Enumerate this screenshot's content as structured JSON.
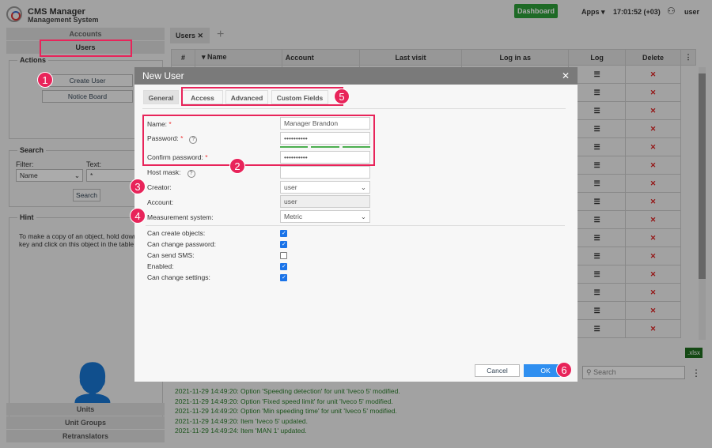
{
  "header": {
    "title": "CMS Manager",
    "subtitle": "Management System",
    "dashboard": "Dashboard",
    "apps": "Apps",
    "time": "17:01:52 (+03)",
    "user": "user"
  },
  "sidebar": {
    "accounts": "Accounts",
    "users": "Users",
    "actions": "Actions",
    "create_user": "Create User",
    "notice_board": "Notice Board",
    "search": "Search",
    "filter_label": "Filter:",
    "filter_value": "Name",
    "text_label": "Text:",
    "text_value": "*",
    "search_btn": "Search",
    "hint": "Hint",
    "hint_text": "To make a copy of an object, hold down Ctrl key and click on this object in the table",
    "units": "Units",
    "unit_groups": "Unit Groups",
    "retranslators": "Retranslators"
  },
  "main": {
    "tab": "Users",
    "columns": [
      "#",
      "Name",
      "Account",
      "Last visit",
      "Log in as",
      "Log",
      "Delete"
    ],
    "xlsx": ".xlsx",
    "search_placeholder": "Search"
  },
  "log": [
    "2021-11-29 14:49:20: Option 'Speeding detection' for unit 'Iveco 5' modified.",
    "2021-11-29 14:49:20: Option 'Fixed speed limit' for unit 'Iveco 5' modified.",
    "2021-11-29 14:49:20: Option 'Min speeding time' for unit 'Iveco 5' modified.",
    "2021-11-29 14:49:20: Item 'Iveco 5' updated.",
    "2021-11-29 14:49:24: Item 'MAN 1' updated."
  ],
  "dialog": {
    "title": "New User",
    "tabs": [
      "General",
      "Access",
      "Advanced",
      "Custom Fields"
    ],
    "name_label": "Name:",
    "name_value": "Manager Brandon",
    "password_label": "Password:",
    "password_value": "••••••••••",
    "confirm_label": "Confirm password:",
    "confirm_value": "••••••••••",
    "hostmask_label": "Host mask:",
    "creator_label": "Creator:",
    "creator_value": "user",
    "account_label": "Account:",
    "account_value": "user",
    "measure_label": "Measurement system:",
    "measure_value": "Metric",
    "checks": [
      {
        "label": "Can create objects:",
        "checked": true
      },
      {
        "label": "Can change password:",
        "checked": true
      },
      {
        "label": "Can send SMS:",
        "checked": false
      },
      {
        "label": "Enabled:",
        "checked": true
      },
      {
        "label": "Can change settings:",
        "checked": true
      }
    ],
    "cancel": "Cancel",
    "ok": "OK"
  },
  "badges": [
    "1",
    "2",
    "3",
    "4",
    "5",
    "6"
  ]
}
